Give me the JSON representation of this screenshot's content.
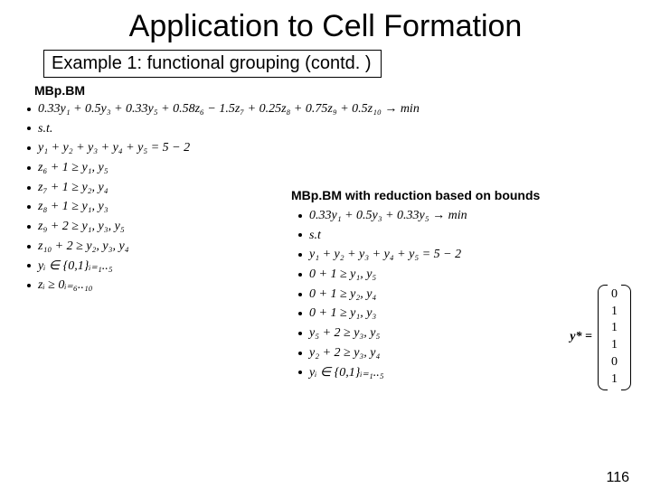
{
  "title": "Application to Cell Formation",
  "subtitle": "Example 1:  functional grouping (contd. )",
  "left": {
    "label": "MBp.BM",
    "objective": "0.33y₁ + 0.5y₃ + 0.33y₅ + 0.58z₆ − 1.5z₇ + 0.25z₈ + 0.75z₉ + 0.5z₁₀ → min",
    "st": "s.t.",
    "c1": "y₁ + y₂ + y₃ + y₄ + y₅ = 5 − 2",
    "c2": "z₆ + 1 ≥ y₁, y₅",
    "c3": "z₇ + 1 ≥ y₂, y₄",
    "c4": "z₈ + 1 ≥ y₁, y₃",
    "c5": "z₉ + 2 ≥ y₁, y₃, y₅",
    "c6": "z₁₀ + 2 ≥ y₂, y₃, y₄",
    "d1": "yᵢ ∈ {0,1}ᵢ₌₁..₅",
    "d2": "zᵢ ≥ 0ᵢ₌₆..₁₀"
  },
  "right": {
    "label": "MBp.BM with reduction based on bounds",
    "objective": "0.33y₁ + 0.5y₃ + 0.33y₅ → min",
    "st": "s.t",
    "c1": "y₁ + y₂ + y₃ + y₄ + y₅ = 5 − 2",
    "c2": "0 + 1 ≥ y₁, y₅",
    "c3": "0 + 1 ≥ y₂, y₄",
    "c4": "0 + 1 ≥ y₁, y₃",
    "c5": "y₅ + 2 ≥ y₃, y₅",
    "c6": "y₂ + 2 ≥ y₃, y₄",
    "d1": "yᵢ ∈ {0,1}ᵢ₌₁..₅"
  },
  "ystar": {
    "label": "y* =",
    "values": [
      "0",
      "1",
      "1",
      "1",
      "0",
      "1"
    ]
  },
  "page": "116"
}
